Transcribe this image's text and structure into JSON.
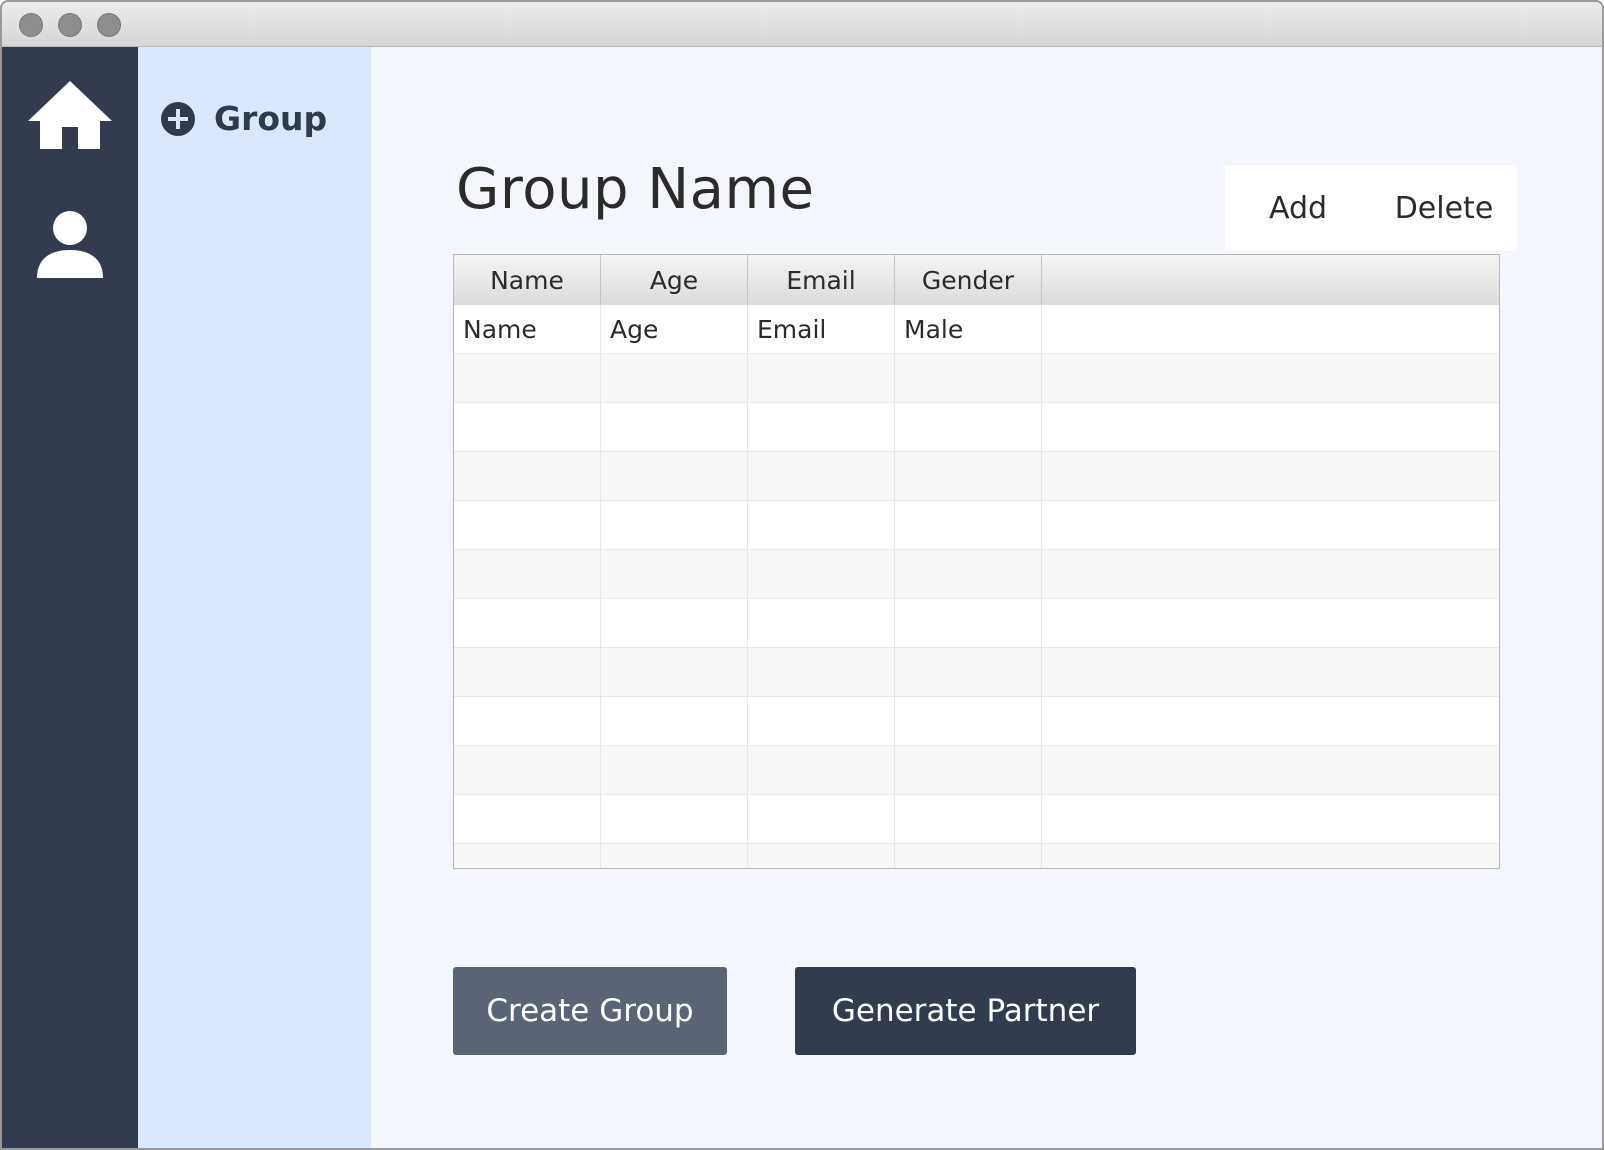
{
  "window": {
    "controls": [
      "close-button",
      "minimize-button",
      "zoom-button"
    ]
  },
  "navbar": {
    "items": [
      {
        "name": "home",
        "icon": "home-icon"
      },
      {
        "name": "user",
        "icon": "user-icon"
      }
    ]
  },
  "sidepanel": {
    "add_group": {
      "icon": "plus-circle-icon",
      "label": "Group"
    }
  },
  "main": {
    "title": "Group Name",
    "add_label": "Add",
    "delete_label": "Delete"
  },
  "table": {
    "columns": [
      "Name",
      "Age",
      "Email",
      "Gender"
    ],
    "rows": [
      [
        "Name",
        "Age",
        "Email",
        "Male"
      ],
      [
        "",
        "",
        "",
        ""
      ],
      [
        "",
        "",
        "",
        ""
      ],
      [
        "",
        "",
        "",
        ""
      ],
      [
        "",
        "",
        "",
        ""
      ],
      [
        "",
        "",
        "",
        ""
      ],
      [
        "",
        "",
        "",
        ""
      ],
      [
        "",
        "",
        "",
        ""
      ],
      [
        "",
        "",
        "",
        ""
      ],
      [
        "",
        "",
        "",
        ""
      ],
      [
        "",
        "",
        "",
        ""
      ],
      [
        "",
        "",
        "",
        ""
      ],
      [
        "",
        "",
        "",
        ""
      ]
    ]
  },
  "actions": {
    "create_group_label": "Create Group",
    "generate_partner_label": "Generate Partner"
  },
  "colors": {
    "navbar_bg": "#313d4f",
    "sidepanel_bg": "#dbe8fc",
    "main_bg": "#f3f7fd",
    "create_btn_bg": "#596474",
    "generate_btn_bg": "#313d4f"
  }
}
